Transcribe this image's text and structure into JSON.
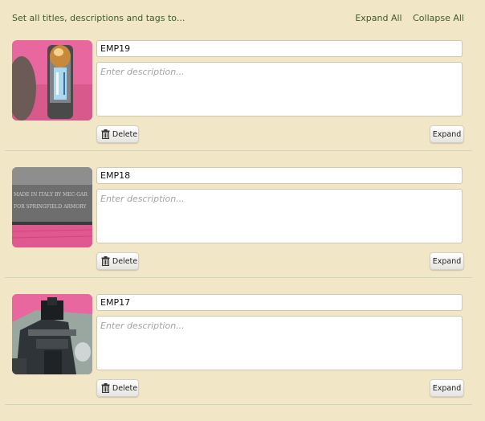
{
  "header": {
    "set_all_label": "Set all titles, descriptions and tags to...",
    "expand_all": "Expand All",
    "collapse_all": "Collapse All"
  },
  "items": [
    {
      "title": "EMP19",
      "description_placeholder": "Enter description...",
      "delete_label": "Delete",
      "expand_label": "Expand",
      "thumbnail": "bullet-cartridge-photo"
    },
    {
      "title": "EMP18",
      "description_placeholder": "Enter description...",
      "delete_label": "Delete",
      "expand_label": "Expand",
      "thumbnail": "engraved-slide-photo",
      "thumbnail_text": [
        "MADE IN ITALY BY MEC-GAR",
        "FOR SPRINGFIELD ARMORY"
      ]
    },
    {
      "title": "EMP17",
      "description_placeholder": "Enter description...",
      "delete_label": "Delete",
      "expand_label": "Expand",
      "thumbnail": "pistol-sights-photo"
    }
  ],
  "colors": {
    "background": "#f1e6c6",
    "link": "#3f5a2a",
    "divider": "#cfd7b5",
    "thumb_pink": "#e8679e"
  }
}
